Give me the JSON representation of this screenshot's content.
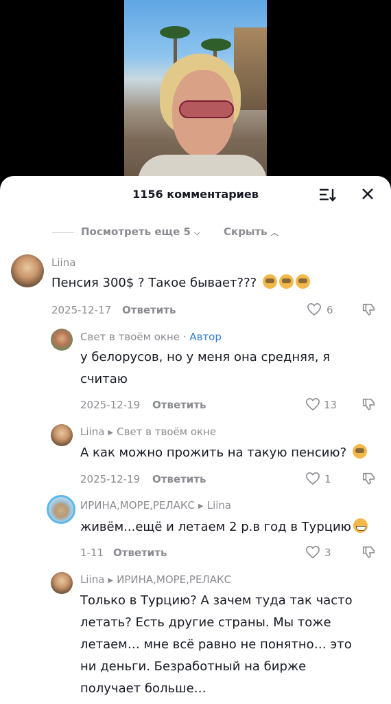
{
  "header": {
    "title": "1156 комментариев"
  },
  "thread": {
    "view_more": "Посмотреть еще 5",
    "hide": "Скрыть"
  },
  "comments": [
    {
      "author": "Liina",
      "author_tag": "",
      "reply_to": "",
      "text": "Пенсия 300$ ? Такое бывает???",
      "emoji_count": 3,
      "date": "2025-12-17",
      "reply": "Ответить",
      "likes": "6"
    },
    {
      "author": "Свет в твоём окне",
      "author_tag": "Автор",
      "reply_to": "",
      "text": "у белорусов, но у меня она средняя, я считаю",
      "date": "2025-12-19",
      "reply": "Ответить",
      "likes": "13"
    },
    {
      "author": "Liina",
      "author_tag": "",
      "reply_to": "Свет в твоём окне",
      "text": "А как можно прожить на такую пенсию?",
      "emoji_count": 1,
      "date": "2025-12-19",
      "reply": "Ответить",
      "likes": "1"
    },
    {
      "author": "ИРИНА,МОРЕ,РЕЛАКС",
      "author_tag": "",
      "reply_to": "Liina",
      "text": "живём...ещё и летаем 2 р.в год в Турцию",
      "emoji_count": 1,
      "date": "1-11",
      "reply": "Ответить",
      "likes": "3"
    },
    {
      "author": "Liina",
      "author_tag": "",
      "reply_to": "ИРИНА,МОРЕ,РЕЛАКС",
      "text": "Только в Турцию? А зачем туда так часто летать? Есть другие страны. Мы тоже летаем… мне всё равно не понятно… это ни деньги. Безработный на бирже получает больше…"
    }
  ]
}
